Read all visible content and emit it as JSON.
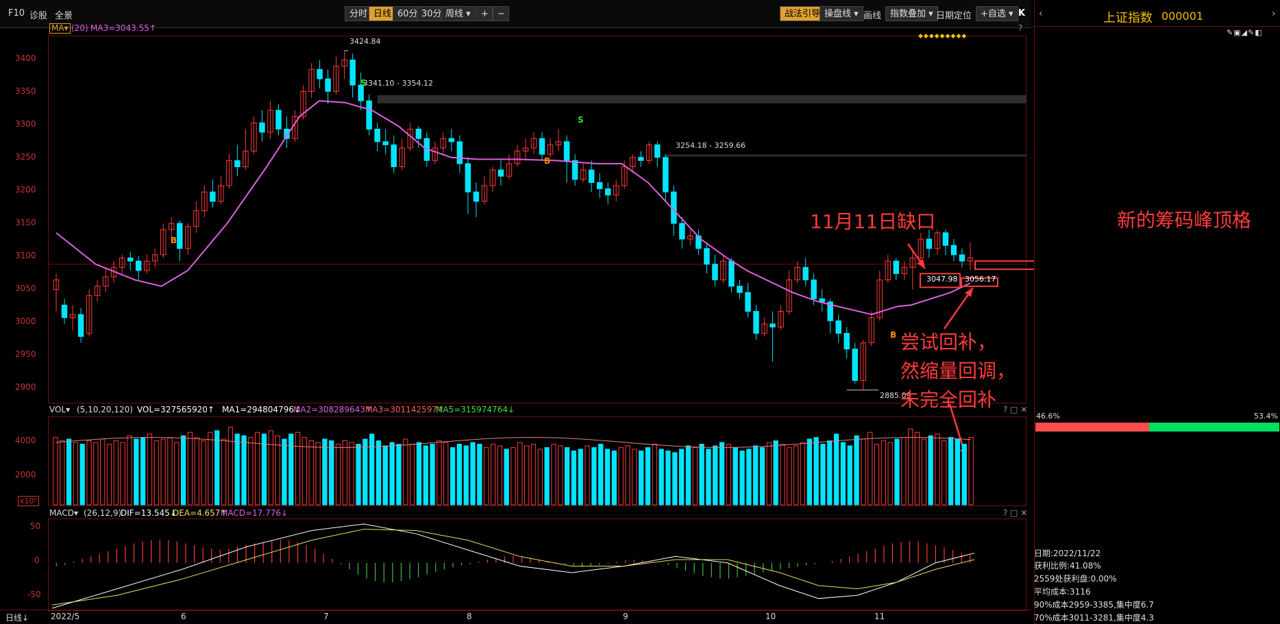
{
  "toolbar": {
    "left_items": [
      "F10",
      "诊股",
      "全景"
    ],
    "periods": [
      "分时",
      "日线",
      "60分",
      "30分",
      "周线"
    ],
    "active_period": "日线",
    "zoom_in": "+",
    "zoom_out": "−",
    "right_items": [
      "战法引导",
      "操盘线",
      "画线",
      "指数叠加",
      "日期定位",
      "+自选"
    ],
    "close_label": "K"
  },
  "main_panel": {
    "indicator_selector": "MA",
    "ma_param": "(20)",
    "ma_value": "MA3=3043.55↑",
    "question": "?",
    "y_labels": [
      "3400",
      "3350",
      "3300",
      "3250",
      "3200",
      "3150",
      "3100",
      "3050",
      "3000",
      "2950",
      "2900"
    ],
    "annotations": {
      "high": "3424.84",
      "gap1": "3341.10 - 3354.12",
      "gap2": "3254.18 - 3259.66",
      "low": "2885.09",
      "gap3_left": "3047.98",
      "gap3_right": "3056.17"
    },
    "signals": [
      "B",
      "S",
      "S",
      "B",
      "B"
    ],
    "diamonds": "◆◆◆◆◆◆◆◆◆"
  },
  "volume_panel": {
    "selector": "VOL",
    "params": "(5,10,20,120)",
    "vol": "VOL=327565920↑",
    "ma1": "MA1=294804796↓",
    "ma2": "MA2=308289643↑",
    "ma3": "MA3=301142597↑",
    "ma5": "MA5=315974764↓",
    "y_labels": [
      "4000",
      "2000"
    ],
    "unit": "x10⁵",
    "controls": "? □ ✕"
  },
  "macd_panel": {
    "selector": "MACD",
    "params": "(26,12,9)",
    "dif": "DIF=13.545↓",
    "dea": "DEA=4.657↑",
    "macd": "MACD=17.776↓",
    "y_labels": [
      "50",
      "0",
      "-50"
    ],
    "controls": "? □ ✕"
  },
  "x_axis": {
    "period_label": "日线↓",
    "labels": [
      "2022/5",
      "6",
      "7",
      "8",
      "9",
      "10",
      "11"
    ]
  },
  "right_panel": {
    "title": "上证指数",
    "code": "000001",
    "left_pct": "46.6%",
    "right_pct": "53.4%",
    "date": "日期:2022/11/22",
    "profit_ratio": "获利比例:41.08%",
    "profit_at": "2559处获利盘:0.00%",
    "avg_cost": "平均成本:3116",
    "cost90": "90%成本2959-3385,集中度6.7",
    "cost70": "70%成本3011-3281,集中度4.3"
  },
  "overlay_notes": {
    "gap_note": "11月11日缺口",
    "peak_note": "新的筹码峰顶格",
    "retrace_note_1": "尝试回补，",
    "retrace_note_2": "然缩量回调，",
    "retrace_note_3": "未完全回补"
  },
  "colors": {
    "up": "#ff3b3b",
    "down": "#00e5ff",
    "ma": "#e060e0",
    "accent": "#e0a030",
    "grid": "#6e1010",
    "chip_green": "#00e060"
  },
  "chart_data": {
    "type": "candlestick",
    "price_ylim": [
      2870,
      3440
    ],
    "volume_ylim": [
      0,
      5000
    ],
    "macd_ylim": [
      -70,
      60
    ],
    "candles": [
      [
        3045,
        3060,
        3010,
        3070
      ],
      [
        3020,
        3000,
        2990,
        3030
      ],
      [
        3000,
        3005,
        2980,
        3020
      ],
      [
        3005,
        2970,
        2960,
        3015
      ],
      [
        2975,
        3035,
        2970,
        3045
      ],
      [
        3035,
        3050,
        3025,
        3060
      ],
      [
        3050,
        3065,
        3040,
        3080
      ],
      [
        3065,
        3080,
        3055,
        3090
      ],
      [
        3080,
        3095,
        3070,
        3100
      ],
      [
        3095,
        3090,
        3075,
        3105
      ],
      [
        3090,
        3075,
        3060,
        3098
      ],
      [
        3075,
        3090,
        3070,
        3100
      ],
      [
        3090,
        3100,
        3080,
        3110
      ],
      [
        3100,
        3140,
        3095,
        3150
      ],
      [
        3140,
        3150,
        3120,
        3160
      ],
      [
        3150,
        3110,
        3090,
        3155
      ],
      [
        3110,
        3145,
        3100,
        3150
      ],
      [
        3145,
        3170,
        3135,
        3185
      ],
      [
        3170,
        3200,
        3160,
        3210
      ],
      [
        3200,
        3185,
        3175,
        3220
      ],
      [
        3185,
        3210,
        3180,
        3225
      ],
      [
        3210,
        3250,
        3205,
        3260
      ],
      [
        3250,
        3240,
        3225,
        3275
      ],
      [
        3240,
        3265,
        3235,
        3300
      ],
      [
        3265,
        3310,
        3260,
        3320
      ],
      [
        3310,
        3295,
        3280,
        3330
      ],
      [
        3295,
        3330,
        3285,
        3345
      ],
      [
        3330,
        3300,
        3290,
        3340
      ],
      [
        3300,
        3285,
        3270,
        3320
      ],
      [
        3285,
        3320,
        3280,
        3330
      ],
      [
        3320,
        3360,
        3315,
        3370
      ],
      [
        3360,
        3395,
        3350,
        3405
      ],
      [
        3395,
        3380,
        3365,
        3410
      ],
      [
        3380,
        3360,
        3340,
        3395
      ],
      [
        3360,
        3400,
        3355,
        3415
      ],
      [
        3400,
        3410,
        3380,
        3425
      ],
      [
        3410,
        3370,
        3350,
        3420
      ],
      [
        3370,
        3345,
        3330,
        3390
      ],
      [
        3345,
        3300,
        3290,
        3355
      ],
      [
        3300,
        3280,
        3265,
        3310
      ],
      [
        3280,
        3275,
        3260,
        3300
      ],
      [
        3275,
        3240,
        3230,
        3290
      ],
      [
        3240,
        3270,
        3235,
        3285
      ],
      [
        3270,
        3300,
        3265,
        3310
      ],
      [
        3300,
        3285,
        3270,
        3305
      ],
      [
        3285,
        3250,
        3240,
        3295
      ],
      [
        3250,
        3270,
        3245,
        3280
      ],
      [
        3270,
        3285,
        3260,
        3295
      ],
      [
        3285,
        3280,
        3265,
        3300
      ],
      [
        3280,
        3245,
        3230,
        3290
      ],
      [
        3245,
        3200,
        3165,
        3255
      ],
      [
        3200,
        3185,
        3160,
        3215
      ],
      [
        3185,
        3210,
        3180,
        3225
      ],
      [
        3210,
        3235,
        3200,
        3240
      ],
      [
        3235,
        3225,
        3210,
        3250
      ],
      [
        3225,
        3245,
        3220,
        3260
      ],
      [
        3245,
        3265,
        3240,
        3275
      ],
      [
        3265,
        3270,
        3250,
        3285
      ],
      [
        3270,
        3285,
        3260,
        3295
      ],
      [
        3285,
        3260,
        3250,
        3295
      ],
      [
        3260,
        3275,
        3255,
        3285
      ],
      [
        3275,
        3280,
        3265,
        3300
      ],
      [
        3280,
        3250,
        3215,
        3290
      ],
      [
        3250,
        3220,
        3210,
        3260
      ],
      [
        3220,
        3235,
        3215,
        3245
      ],
      [
        3235,
        3215,
        3200,
        3250
      ],
      [
        3215,
        3205,
        3190,
        3230
      ],
      [
        3205,
        3195,
        3180,
        3215
      ],
      [
        3195,
        3210,
        3185,
        3220
      ],
      [
        3210,
        3240,
        3205,
        3250
      ],
      [
        3240,
        3255,
        3230,
        3260
      ],
      [
        3255,
        3250,
        3240,
        3265
      ],
      [
        3250,
        3275,
        3245,
        3280
      ],
      [
        3275,
        3255,
        3240,
        3280
      ],
      [
        3255,
        3200,
        3185,
        3260
      ],
      [
        3200,
        3150,
        3130,
        3210
      ],
      [
        3150,
        3125,
        3110,
        3160
      ],
      [
        3125,
        3130,
        3115,
        3140
      ],
      [
        3130,
        3110,
        3100,
        3140
      ],
      [
        3110,
        3085,
        3070,
        3120
      ],
      [
        3085,
        3060,
        3050,
        3100
      ],
      [
        3060,
        3090,
        3055,
        3100
      ],
      [
        3090,
        3050,
        3040,
        3095
      ],
      [
        3050,
        3040,
        3030,
        3060
      ],
      [
        3040,
        3010,
        3000,
        3055
      ],
      [
        3010,
        2975,
        2965,
        3020
      ],
      [
        2975,
        2990,
        2970,
        3000
      ],
      [
        2990,
        2985,
        2930,
        3010
      ],
      [
        2985,
        3010,
        2980,
        3020
      ],
      [
        3010,
        3060,
        3005,
        3075
      ],
      [
        3060,
        3080,
        3055,
        3090
      ],
      [
        3080,
        3060,
        3050,
        3095
      ],
      [
        3060,
        3030,
        3020,
        3070
      ],
      [
        3030,
        3025,
        3010,
        3045
      ],
      [
        3025,
        2995,
        2975,
        3030
      ],
      [
        2995,
        2975,
        2960,
        3005
      ],
      [
        2975,
        2950,
        2935,
        2985
      ],
      [
        2950,
        2900,
        2895,
        2960
      ],
      [
        2900,
        2960,
        2885,
        2965
      ],
      [
        2960,
        3000,
        2955,
        3010
      ],
      [
        3000,
        3060,
        2995,
        3075
      ],
      [
        3060,
        3090,
        3055,
        3100
      ],
      [
        3090,
        3070,
        3060,
        3095
      ],
      [
        3070,
        3080,
        3060,
        3090
      ],
      [
        3080,
        3095,
        3045,
        3110
      ],
      [
        3095,
        3125,
        3085,
        3135
      ],
      [
        3125,
        3110,
        3095,
        3140
      ],
      [
        3110,
        3135,
        3100,
        3140
      ],
      [
        3135,
        3115,
        3100,
        3140
      ],
      [
        3115,
        3100,
        3090,
        3125
      ],
      [
        3100,
        3090,
        3080,
        3110
      ],
      [
        3090,
        3095,
        3075,
        3120
      ]
    ],
    "ma20": [
      [
        0,
        3135
      ],
      [
        6,
        3085
      ],
      [
        12,
        3060
      ],
      [
        16,
        3050
      ],
      [
        20,
        3075
      ],
      [
        26,
        3150
      ],
      [
        32,
        3240
      ],
      [
        37,
        3320
      ],
      [
        40,
        3345
      ],
      [
        44,
        3342
      ],
      [
        48,
        3330
      ],
      [
        52,
        3305
      ],
      [
        56,
        3270
      ],
      [
        60,
        3255
      ],
      [
        64,
        3252
      ],
      [
        70,
        3252
      ],
      [
        76,
        3250
      ],
      [
        82,
        3245
      ],
      [
        86,
        3245
      ],
      [
        90,
        3215
      ],
      [
        94,
        3170
      ],
      [
        98,
        3125
      ],
      [
        102,
        3095
      ],
      [
        105,
        3075
      ],
      [
        108,
        3060
      ],
      [
        112,
        3040
      ],
      [
        116,
        3025
      ],
      [
        120,
        3015
      ],
      [
        124,
        3005
      ],
      [
        128,
        3018
      ],
      [
        130,
        3020
      ],
      [
        133,
        3030
      ],
      [
        136,
        3040
      ],
      [
        139,
        3055
      ]
    ],
    "volumes": [
      4000,
      3800,
      3900,
      3700,
      3600,
      3800,
      3700,
      3900,
      3600,
      3800,
      3700,
      4100,
      3900,
      4000,
      4200,
      3800,
      3900,
      4000,
      3700,
      4100,
      4300,
      4000,
      3800,
      4300,
      4400,
      3900,
      4600,
      4200,
      4100,
      4000,
      4300,
      4200,
      4400,
      4100,
      3900,
      4200,
      4300,
      4000,
      3800,
      3700,
      3900,
      3800,
      3600,
      3800,
      3700,
      3600,
      3900,
      4200,
      3800,
      3500,
      3700,
      3600,
      3900,
      3600,
      3700,
      3500,
      3600,
      3800,
      3700,
      3400,
      3600,
      3500,
      3700,
      3600,
      3400,
      3600,
      3500,
      3300,
      3400,
      3700,
      3500,
      3600,
      3300,
      3400,
      3600,
      3500,
      3400,
      3200,
      3300,
      3500,
      3400,
      3600,
      3300,
      3200,
      3400,
      3500,
      3300,
      3200,
      3400,
      3600,
      3300,
      3200,
      3100,
      3300,
      3500,
      3400,
      3600,
      3300,
      3500,
      3700,
      3600,
      3400,
      3200,
      3300,
      3500,
      3400,
      3700,
      3800,
      3600,
      3400,
      3500,
      3700,
      3900,
      4000,
      3600,
      3800,
      4200,
      3700,
      3500,
      4100,
      3900,
      4300,
      3600,
      3800,
      3700,
      3900,
      4000,
      4500,
      4300,
      3900,
      4100,
      4200,
      3800,
      4000,
      3900,
      3600,
      4000
    ],
    "macd_hist": [
      -5,
      -3,
      2,
      6,
      10,
      14,
      18,
      22,
      26,
      30,
      33,
      35,
      36,
      35,
      33,
      30,
      27,
      24,
      22,
      20,
      22,
      25,
      28,
      30,
      32,
      35,
      36,
      35,
      32,
      28,
      22,
      14,
      6,
      -2,
      -10,
      -18,
      -24,
      -28,
      -30,
      -30,
      -28,
      -25,
      -22,
      -18,
      -14,
      -10,
      -7,
      -4,
      -2,
      2,
      5,
      8,
      10,
      11,
      10,
      8,
      5,
      3,
      1,
      -2,
      -4,
      -6,
      -5,
      -3,
      -1,
      2,
      4,
      5,
      4,
      2,
      0,
      -3,
      -8,
      -12,
      -16,
      -20,
      -22,
      -24,
      -24,
      -22,
      -20,
      -18,
      -15,
      -12,
      -10,
      -8,
      -6,
      -4,
      -2,
      0,
      3,
      6,
      10,
      14,
      18,
      22,
      26,
      30,
      32,
      34,
      33,
      30,
      27,
      24,
      20,
      15,
      12
    ],
    "macd_dif": [
      [
        0,
        -70
      ],
      [
        10,
        -40
      ],
      [
        20,
        -10
      ],
      [
        30,
        25
      ],
      [
        40,
        50
      ],
      [
        48,
        60
      ],
      [
        56,
        45
      ],
      [
        64,
        20
      ],
      [
        72,
        -5
      ],
      [
        80,
        -15
      ],
      [
        88,
        -5
      ],
      [
        96,
        10
      ],
      [
        104,
        0
      ],
      [
        112,
        -35
      ],
      [
        118,
        -55
      ],
      [
        124,
        -50
      ],
      [
        130,
        -30
      ],
      [
        136,
        0
      ],
      [
        142,
        15
      ]
    ],
    "macd_dea": [
      [
        0,
        -65
      ],
      [
        10,
        -50
      ],
      [
        20,
        -25
      ],
      [
        30,
        5
      ],
      [
        40,
        35
      ],
      [
        48,
        52
      ],
      [
        56,
        50
      ],
      [
        64,
        35
      ],
      [
        72,
        10
      ],
      [
        80,
        -5
      ],
      [
        88,
        -5
      ],
      [
        96,
        5
      ],
      [
        104,
        5
      ],
      [
        112,
        -15
      ],
      [
        118,
        -35
      ],
      [
        124,
        -40
      ],
      [
        130,
        -30
      ],
      [
        136,
        -10
      ],
      [
        142,
        5
      ]
    ],
    "chip_rows": [
      [
        0,
        5,
        "r"
      ],
      [
        1,
        8,
        "g"
      ],
      [
        2,
        10,
        "r"
      ],
      [
        3,
        14,
        "g"
      ],
      [
        4,
        18,
        "r"
      ],
      [
        5,
        25,
        "g"
      ],
      [
        6,
        30,
        "r"
      ],
      [
        7,
        22,
        "g"
      ],
      [
        8,
        35,
        "r"
      ],
      [
        9,
        40,
        "g"
      ],
      [
        10,
        28,
        "r"
      ],
      [
        11,
        45,
        "g"
      ],
      [
        12,
        55,
        "r"
      ],
      [
        13,
        70,
        "g"
      ],
      [
        14,
        85,
        "r"
      ],
      [
        15,
        120,
        "g"
      ],
      [
        16,
        150,
        "r"
      ],
      [
        17,
        180,
        "g"
      ],
      [
        18,
        240,
        "g"
      ],
      [
        19,
        160,
        "r"
      ],
      [
        20,
        210,
        "g"
      ],
      [
        21,
        190,
        "r"
      ],
      [
        22,
        170,
        "g"
      ],
      [
        23,
        110,
        "r"
      ],
      [
        24,
        130,
        "g"
      ],
      [
        25,
        90,
        "r"
      ],
      [
        26,
        100,
        "g"
      ],
      [
        27,
        80,
        "r"
      ],
      [
        28,
        60,
        "g"
      ],
      [
        29,
        50,
        "r"
      ],
      [
        30,
        65,
        "g"
      ],
      [
        31,
        70,
        "r"
      ],
      [
        32,
        90,
        "g"
      ],
      [
        33,
        120,
        "r"
      ],
      [
        34,
        160,
        "g"
      ],
      [
        35,
        200,
        "r"
      ],
      [
        36,
        260,
        "g"
      ],
      [
        37,
        295,
        "r"
      ],
      [
        38,
        300,
        "o"
      ],
      [
        39,
        260,
        "g"
      ],
      [
        40,
        200,
        "r"
      ],
      [
        41,
        180,
        "g"
      ],
      [
        42,
        150,
        "r"
      ],
      [
        43,
        120,
        "g"
      ],
      [
        44,
        140,
        "r"
      ],
      [
        45,
        130,
        "g"
      ],
      [
        46,
        100,
        "r"
      ],
      [
        47,
        90,
        "g"
      ],
      [
        48,
        70,
        "r"
      ],
      [
        49,
        50,
        "g"
      ],
      [
        50,
        40,
        "r"
      ],
      [
        51,
        30,
        "g"
      ],
      [
        52,
        25,
        "r"
      ],
      [
        53,
        20,
        "g"
      ],
      [
        54,
        15,
        "r"
      ]
    ]
  }
}
